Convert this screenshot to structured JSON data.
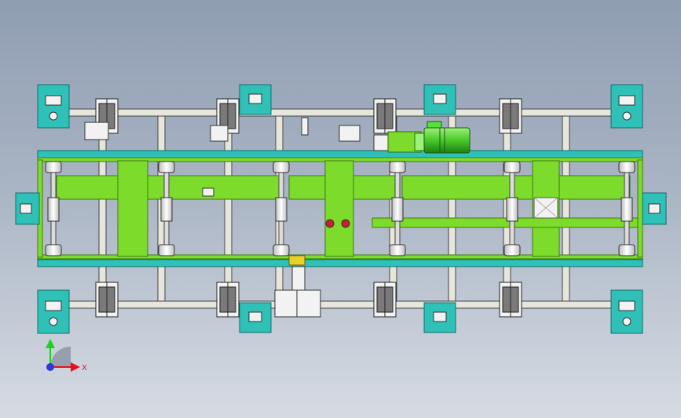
{
  "viewport": {
    "background_top": "#8f9db2",
    "background_bottom": "#d6dbe3"
  },
  "colors": {
    "frame_cyan": "#2fc0b8",
    "frame_cyan_dark": "#0f6f6a",
    "plate_green": "#7ddb2c",
    "plate_green_dark": "#3f7a12",
    "motor_green": "#55e03a",
    "rail_grey": "#e6e6dc",
    "part_white": "#f2f2f2",
    "part_dark": "#333333"
  },
  "model": {
    "parts": [
      "mounting-plate",
      "frame-rail",
      "roller",
      "gear-unit",
      "drive-motor"
    ]
  },
  "triad": {
    "x_label": "X",
    "y_color": "#1fd11f",
    "x_color": "#e8101a",
    "origin_color": "#2a3ad8"
  }
}
